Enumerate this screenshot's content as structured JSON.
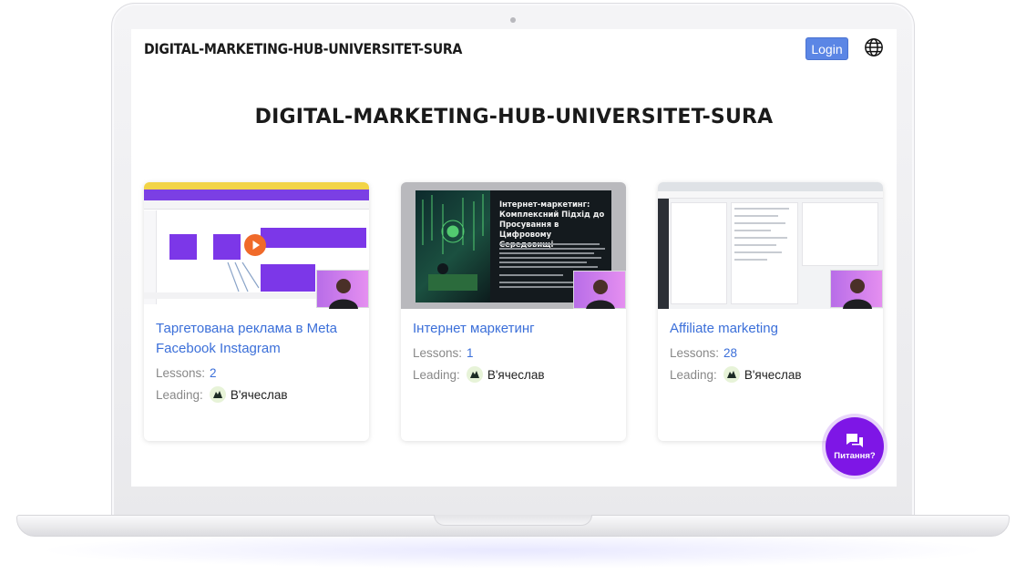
{
  "header": {
    "brand": "DIGITAL-MARKETING-HUB-UNIVERSITET-SURA",
    "login_label": "Login",
    "language_icon": "globe-icon"
  },
  "main": {
    "title": "DIGITAL-MARKETING-HUB-UNIVERSITET-SURA"
  },
  "courses": [
    {
      "title": "Таргетована реклама в Meta Facebook Instagram",
      "lessons_label": "Lessons:",
      "lessons": "2",
      "leading_label": "Leading:",
      "author": "В'ячеслав"
    },
    {
      "title": "Інтернет маркетинг",
      "lessons_label": "Lessons:",
      "lessons": "1",
      "leading_label": "Leading:",
      "author": "В'ячеслав",
      "thumbnail_text": {
        "heading": "Інтернет-маркетинг: Комплексний Підхід до Просування в Цифровому Середовищі"
      }
    },
    {
      "title": "Affiliate marketing",
      "lessons_label": "Lessons:",
      "lessons": "28",
      "leading_label": "Leading:",
      "author": "В'ячеслав"
    }
  ],
  "chat": {
    "label": "Питання?",
    "icon": "chat-bubbles-icon",
    "color": "#7e16e6"
  },
  "colors": {
    "link": "#3b6fd9",
    "login_button": "#5b86e5"
  }
}
